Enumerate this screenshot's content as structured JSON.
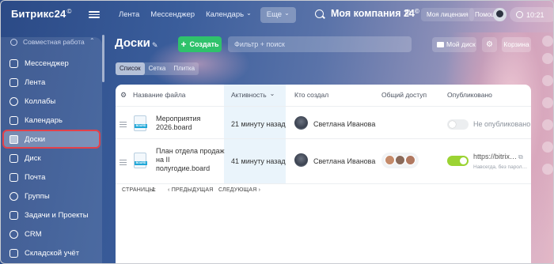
{
  "app": {
    "logo": "Битрикс24",
    "logo_sup": "©"
  },
  "topnav": {
    "items": [
      "Лента",
      "Мессенджер",
      "Календарь",
      "Еще"
    ],
    "company": "Моя компания 24",
    "company_sup": "©",
    "license_btn": "Моя лицензия",
    "help_btn": "Помощь",
    "time": "10:21"
  },
  "sidebar": {
    "group_label": "Совместная работа",
    "items": [
      {
        "label": "Мессенджер"
      },
      {
        "label": "Лента"
      },
      {
        "label": "Коллабы"
      },
      {
        "label": "Календарь"
      },
      {
        "label": "Доски"
      },
      {
        "label": "Диск"
      },
      {
        "label": "Почта"
      },
      {
        "label": "Группы"
      },
      {
        "label": "Задачи и Проекты"
      },
      {
        "label": "CRM"
      },
      {
        "label": "Складской учёт"
      }
    ],
    "active_index": 4
  },
  "page": {
    "title": "Доски",
    "create_label": "Создать",
    "create_plus": "+",
    "filter_placeholder": "Фильтр + поиск",
    "mydisk_label": "Мой диск",
    "trash_label": "Корзина",
    "views": [
      "Список",
      "Сетка",
      "Плитка"
    ],
    "active_view": "Список"
  },
  "table": {
    "columns": [
      "Название файла",
      "Активность",
      "Кто создал",
      "Общий доступ",
      "Опубликовано"
    ],
    "sorted_column": "Активность",
    "rows": [
      {
        "name_line1": "Мероприятия",
        "name_line2": "2026.board",
        "name_line3": "",
        "activity": "21 минуту назад",
        "creator": "Светлана Иванова",
        "shared": false,
        "published": false,
        "published_text": "Не опубликовано",
        "published_sub": ""
      },
      {
        "name_line1": "План отдела продаж",
        "name_line2": "на II",
        "name_line3": "полугодие.board",
        "activity": "41 минуту назад",
        "creator": "Светлана Иванова",
        "shared": true,
        "published": true,
        "published_text": "https://bitrix…",
        "published_sub": "Навсегда, без парол…"
      }
    ],
    "pager": {
      "pages_label": "СТРАНИЦЫ:",
      "page": "1",
      "prev": "ПРЕДЫДУЩАЯ",
      "next": "СЛЕДУЮЩАЯ",
      "prev_arrow": "‹",
      "next_arrow": "›"
    }
  },
  "colors": {
    "accent_green": "#2fc26b",
    "toggle_on": "#9bd333",
    "active_outline": "#e3414a"
  }
}
